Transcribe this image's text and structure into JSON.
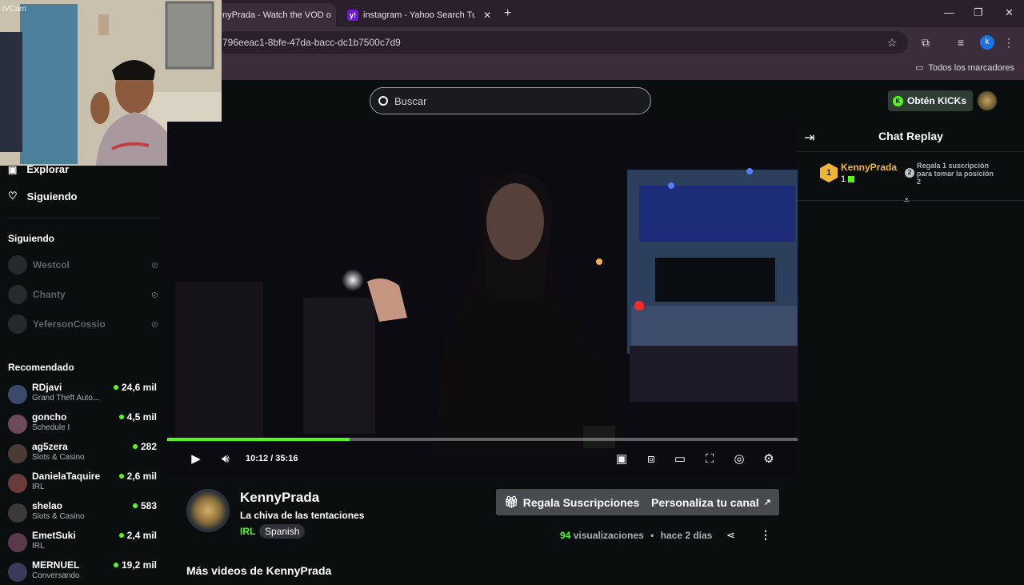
{
  "browser": {
    "tabs": [
      {
        "title": "nyPrada - Watch the VOD o",
        "active": true
      },
      {
        "title": "instagram - Yahoo Search Tus r",
        "active": false
      }
    ],
    "new_tab": "+",
    "url": "796eeac1-8bfe-47da-bacc-dc1b7500c7d9",
    "bookmarks_label": "Todos los marcadores",
    "profile_initial": "k"
  },
  "webcam": {
    "watermark": "iVCam"
  },
  "header": {
    "search_placeholder": "Buscar",
    "kicks_button": "Obtén KICKs"
  },
  "sidebar": {
    "nav": [
      {
        "label": "Explorar",
        "icon": "explore-icon"
      },
      {
        "label": "Siguiendo",
        "icon": "heart-icon"
      }
    ],
    "following_title": "Siguiendo",
    "following": [
      {
        "name": "Westcol"
      },
      {
        "name": "Chanty"
      },
      {
        "name": "YefersonCossio"
      }
    ],
    "recommended_title": "Recomendado",
    "recommended": [
      {
        "name": "RDjavi",
        "category": "Grand Theft Auto...",
        "viewers": "24,6 mil"
      },
      {
        "name": "goncho",
        "category": "Schedule I",
        "viewers": "4,5 mil"
      },
      {
        "name": "ag5zera",
        "category": "Slots & Casino",
        "viewers": "282"
      },
      {
        "name": "DanielaTaquire",
        "category": "IRL",
        "viewers": "2,6 mil"
      },
      {
        "name": "shelao",
        "category": "Slots & Casino",
        "viewers": "583"
      },
      {
        "name": "EmetSuki",
        "category": "IRL",
        "viewers": "2,4 mil"
      },
      {
        "name": "MERNUEL",
        "category": "Conversando",
        "viewers": "19,2 mil"
      }
    ]
  },
  "player": {
    "current_time": "10:12",
    "duration": "35:16",
    "progress": 0.289,
    "timecode": "10:12 / 35:16"
  },
  "chat": {
    "title": "Chat Replay",
    "leader": {
      "rank": "1",
      "name": "KennyPrada",
      "count": "1"
    },
    "position2": {
      "rank": "2",
      "text": "Regala 1 suscripción para tomar la posición 2"
    }
  },
  "channel": {
    "name": "KennyPrada",
    "vod_title": "La chiva de las tentaciones",
    "category": "IRL",
    "language": "Spanish",
    "gift_button": "Regala Suscripciones",
    "customize_button": "Personaliza tu canal",
    "views_count": "94",
    "views_label": "visualizaciones",
    "separator": "•",
    "age": "hace 2 días",
    "more_videos": "Más videos de KennyPrada"
  },
  "colors": {
    "brand": "#53fc18",
    "bg": "#0b0e0f",
    "gold": "#f2b634"
  }
}
